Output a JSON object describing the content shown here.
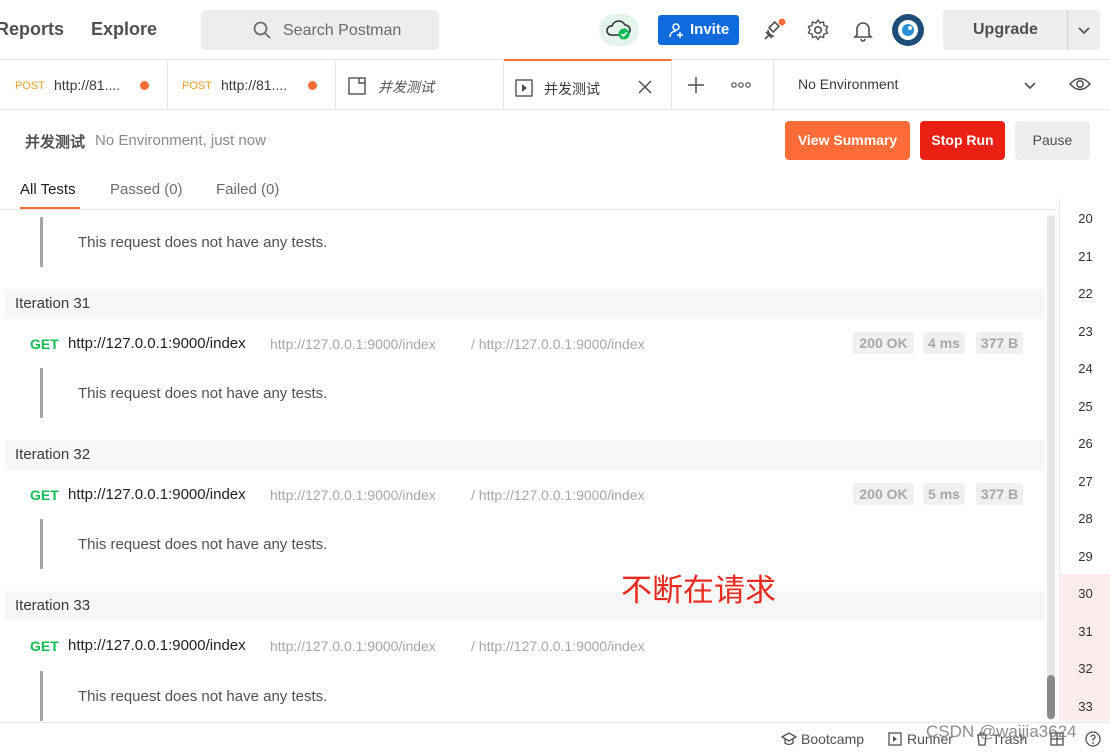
{
  "topbar": {
    "nav": [
      "Reports",
      "Explore"
    ],
    "search_placeholder": "Search Postman",
    "invite_label": "Invite",
    "upgrade_label": "Upgrade"
  },
  "tabs": [
    {
      "method": "POST",
      "name": "http://81....",
      "unsaved": true
    },
    {
      "method": "POST",
      "name": "http://81....",
      "unsaved": true
    },
    {
      "name": "并发测试",
      "italic": true
    },
    {
      "name": "并发测试",
      "active": true
    }
  ],
  "environment": {
    "label": "No Environment"
  },
  "runner": {
    "title": "并发测试",
    "meta": "No Environment, just now",
    "view_summary": "View Summary",
    "stop_run": "Stop Run",
    "pause": "Pause",
    "tabs": [
      "All Tests",
      "Passed (0)",
      "Failed (0)"
    ]
  },
  "results": {
    "top_message": "This request does not have any tests.",
    "iterations": [
      {
        "title": "Iteration 31",
        "method": "GET",
        "url": "http://127.0.0.1:9000/index",
        "url_resolved": "http://127.0.0.1:9000/index",
        "url_path": "/ http://127.0.0.1:9000/index",
        "status": "200 OK",
        "time": "4 ms",
        "size": "377 B",
        "message": "This request does not have any tests."
      },
      {
        "title": "Iteration 32",
        "method": "GET",
        "url": "http://127.0.0.1:9000/index",
        "url_resolved": "http://127.0.0.1:9000/index",
        "url_path": "/ http://127.0.0.1:9000/index",
        "status": "200 OK",
        "time": "5 ms",
        "size": "377 B",
        "message": "This request does not have any tests."
      },
      {
        "title": "Iteration 33",
        "method": "GET",
        "url": "http://127.0.0.1:9000/index",
        "url_resolved": "http://127.0.0.1:9000/index",
        "url_path": "/ http://127.0.0.1:9000/index",
        "message": "This request does not have any tests."
      }
    ]
  },
  "line_numbers": [
    "20",
    "21",
    "22",
    "23",
    "24",
    "25",
    "26",
    "27",
    "28",
    "29",
    "30",
    "31",
    "32",
    "33"
  ],
  "annotation": "不断在请求",
  "statusbar": {
    "bootcamp": "Bootcamp",
    "runner": "Runner",
    "trash": "Trash"
  },
  "watermark": "CSDN @waijia3624",
  "colors": {
    "accent": "#ff6c37",
    "stop": "#eb2013",
    "invite": "#0f6bdb",
    "get": "#0cbb52",
    "annotation": "#ea2a1e"
  }
}
